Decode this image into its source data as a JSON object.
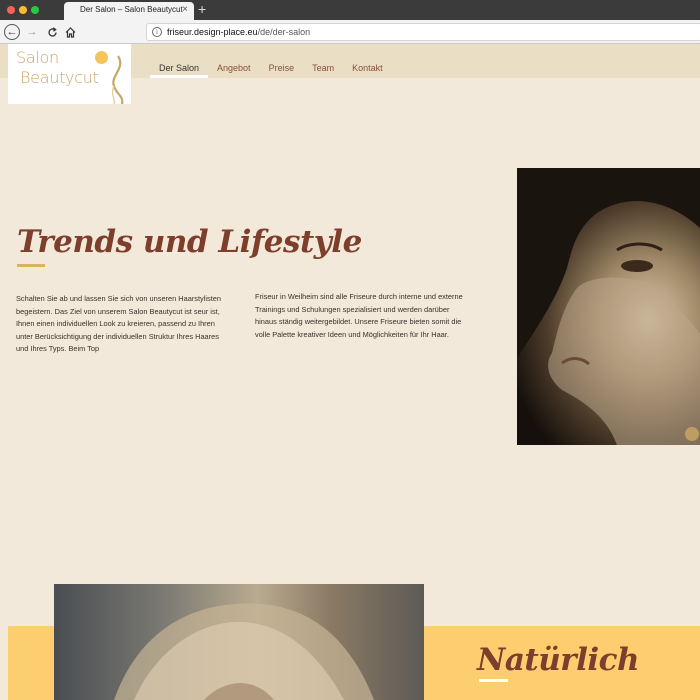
{
  "browser": {
    "tab_title": "Der Salon – Salon Beautycut",
    "tab_close": "×",
    "new_tab": "+",
    "url_host": "friseur.design-place.eu",
    "url_path": "/de/der-salon"
  },
  "site": {
    "logo": {
      "line1": "Salon",
      "line2": "Beautycut"
    },
    "nav": [
      {
        "label": "Der Salon",
        "active": true
      },
      {
        "label": "Angebot"
      },
      {
        "label": "Preise"
      },
      {
        "label": "Team"
      },
      {
        "label": "Kontakt"
      }
    ],
    "hero_title": "Trends und Lifestyle",
    "paragraph_1": "Schalten Sie ab und lassen Sie sich von unseren Haarstylisten begeistern. Das Ziel von unserem Salon Beautycut ist seur ist, Ihnen einen individuellen Look zu kreieren, passend zu Ihren unter Berücksichtigung der individuellen Struktur Ihres Haares und Ihres Typs. Beim Top",
    "paragraph_2": "Friseur in Weilheim sind alle Friseure durch interne und externe Trainings und Schulungen spezialisiert und werden darüber hinaus ständig weitergebildet. Unsere Friseure bieten somit die volle Palette kreativer Ideen und Möglichkeiten für Ihr Haar.",
    "second_title": "Natürlich"
  },
  "colors": {
    "accent_brown": "#7d3e2b",
    "accent_gold": "#d9b460",
    "band_yellow": "#fdce70",
    "page_bg": "#f2e9da",
    "header_bg": "#eadfc4"
  }
}
